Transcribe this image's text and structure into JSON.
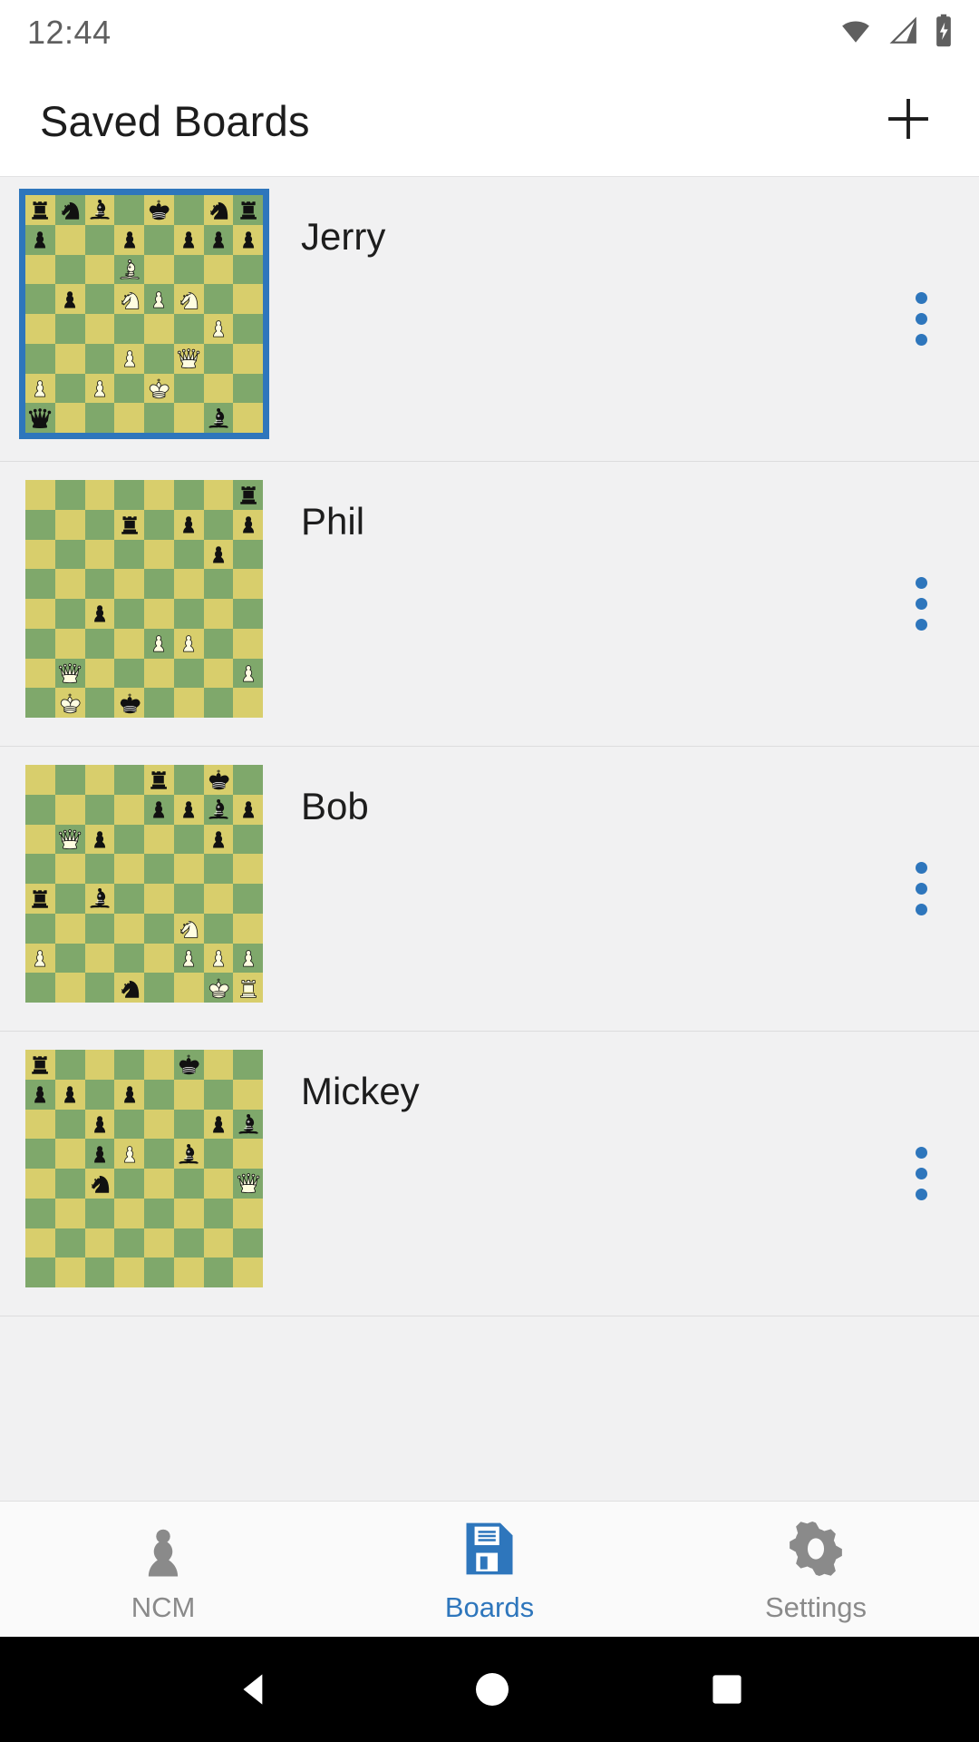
{
  "status_bar": {
    "time": "12:44",
    "icons": [
      "wifi-icon",
      "cellular-signal-icon",
      "battery-charging-icon"
    ]
  },
  "app_bar": {
    "title": "Saved Boards",
    "add_icon": "plus-icon",
    "add_label": "Add board"
  },
  "board_theme": {
    "light_square": "#d8ce6c",
    "dark_square": "#7fa86b",
    "selected_border": "#2e76bc",
    "white_piece_fill": "#fffde0",
    "black_piece_fill": "#111111"
  },
  "boards": [
    {
      "name": "Jerry",
      "selected": true,
      "overflow_icon": "more-vertical-icon",
      "position": [
        [
          "r",
          "n",
          "b",
          "",
          "k",
          "",
          "n",
          "r"
        ],
        [
          "p",
          "",
          "",
          "p",
          "",
          "p",
          "p",
          "p"
        ],
        [
          "",
          "",
          "",
          "B",
          "",
          "",
          "",
          ""
        ],
        [
          "",
          "p",
          "",
          "N",
          "P",
          "N",
          "",
          ""
        ],
        [
          "",
          "",
          "",
          "",
          "",
          "",
          "P",
          ""
        ],
        [
          "",
          "",
          "",
          "P",
          "",
          "Q",
          "",
          ""
        ],
        [
          "P",
          "",
          "P",
          "",
          "K",
          "",
          "",
          ""
        ],
        [
          "q",
          "",
          "",
          "",
          "",
          "",
          "b",
          ""
        ]
      ]
    },
    {
      "name": "Phil",
      "selected": false,
      "overflow_icon": "more-vertical-icon",
      "position": [
        [
          "",
          "",
          "",
          "",
          "",
          "",
          "",
          "r"
        ],
        [
          "",
          "",
          "",
          "r",
          "",
          "p",
          "",
          "p"
        ],
        [
          "",
          "",
          "",
          "",
          "",
          "",
          "p",
          ""
        ],
        [
          "",
          "",
          "",
          "",
          "",
          "",
          "",
          ""
        ],
        [
          "",
          "",
          "p",
          "",
          "",
          "",
          "",
          ""
        ],
        [
          "",
          "",
          "",
          "",
          "P",
          "P",
          "",
          ""
        ],
        [
          "",
          "Q",
          "",
          "",
          "",
          "",
          "",
          "P"
        ],
        [
          "",
          "K",
          "",
          "k",
          "",
          "",
          "",
          ""
        ]
      ]
    },
    {
      "name": "Bob",
      "selected": false,
      "overflow_icon": "more-vertical-icon",
      "position": [
        [
          "",
          "",
          "",
          "",
          "r",
          "",
          "k",
          ""
        ],
        [
          "",
          "",
          "",
          "",
          "p",
          "p",
          "b",
          "p"
        ],
        [
          "",
          "Q",
          "p",
          "",
          "",
          "",
          "p",
          ""
        ],
        [
          "",
          "",
          "",
          "",
          "",
          "",
          "",
          ""
        ],
        [
          "r",
          "",
          "b",
          "",
          "",
          "",
          "",
          ""
        ],
        [
          "",
          "",
          "",
          "",
          "",
          "N",
          "",
          ""
        ],
        [
          "P",
          "",
          "",
          "",
          "",
          "P",
          "P",
          "P"
        ],
        [
          "",
          "",
          "",
          "n",
          "",
          "",
          "K",
          "R"
        ]
      ]
    },
    {
      "name": "Mickey",
      "selected": false,
      "overflow_icon": "more-vertical-icon",
      "position": [
        [
          "r",
          "",
          "",
          "",
          "",
          "k",
          "",
          ""
        ],
        [
          "p",
          "p",
          "",
          "p",
          "",
          "",
          "",
          ""
        ],
        [
          "",
          "",
          "p",
          "",
          "",
          "",
          "p",
          "b"
        ],
        [
          "",
          "",
          "p",
          "P",
          "",
          "b",
          "",
          ""
        ],
        [
          "",
          "",
          "n",
          "",
          "",
          "",
          "",
          "Q"
        ],
        [
          "",
          "",
          "",
          "",
          "",
          "",
          "",
          ""
        ],
        [
          "",
          "",
          "",
          "",
          "",
          "",
          "",
          ""
        ],
        [
          "",
          "",
          "",
          "",
          "",
          "",
          "",
          ""
        ]
      ]
    }
  ],
  "bottom_nav": {
    "items": [
      {
        "label": "NCM",
        "icon": "chess-pawn-icon",
        "active": false
      },
      {
        "label": "Boards",
        "icon": "floppy-disk-icon",
        "active": true
      },
      {
        "label": "Settings",
        "icon": "gear-icon",
        "active": false
      }
    ],
    "active_color": "#2e76bc",
    "inactive_color": "#8a8a8a"
  },
  "system_nav": {
    "back_icon": "triangle-back-icon",
    "home_icon": "circle-home-icon",
    "recents_icon": "square-recents-icon"
  }
}
